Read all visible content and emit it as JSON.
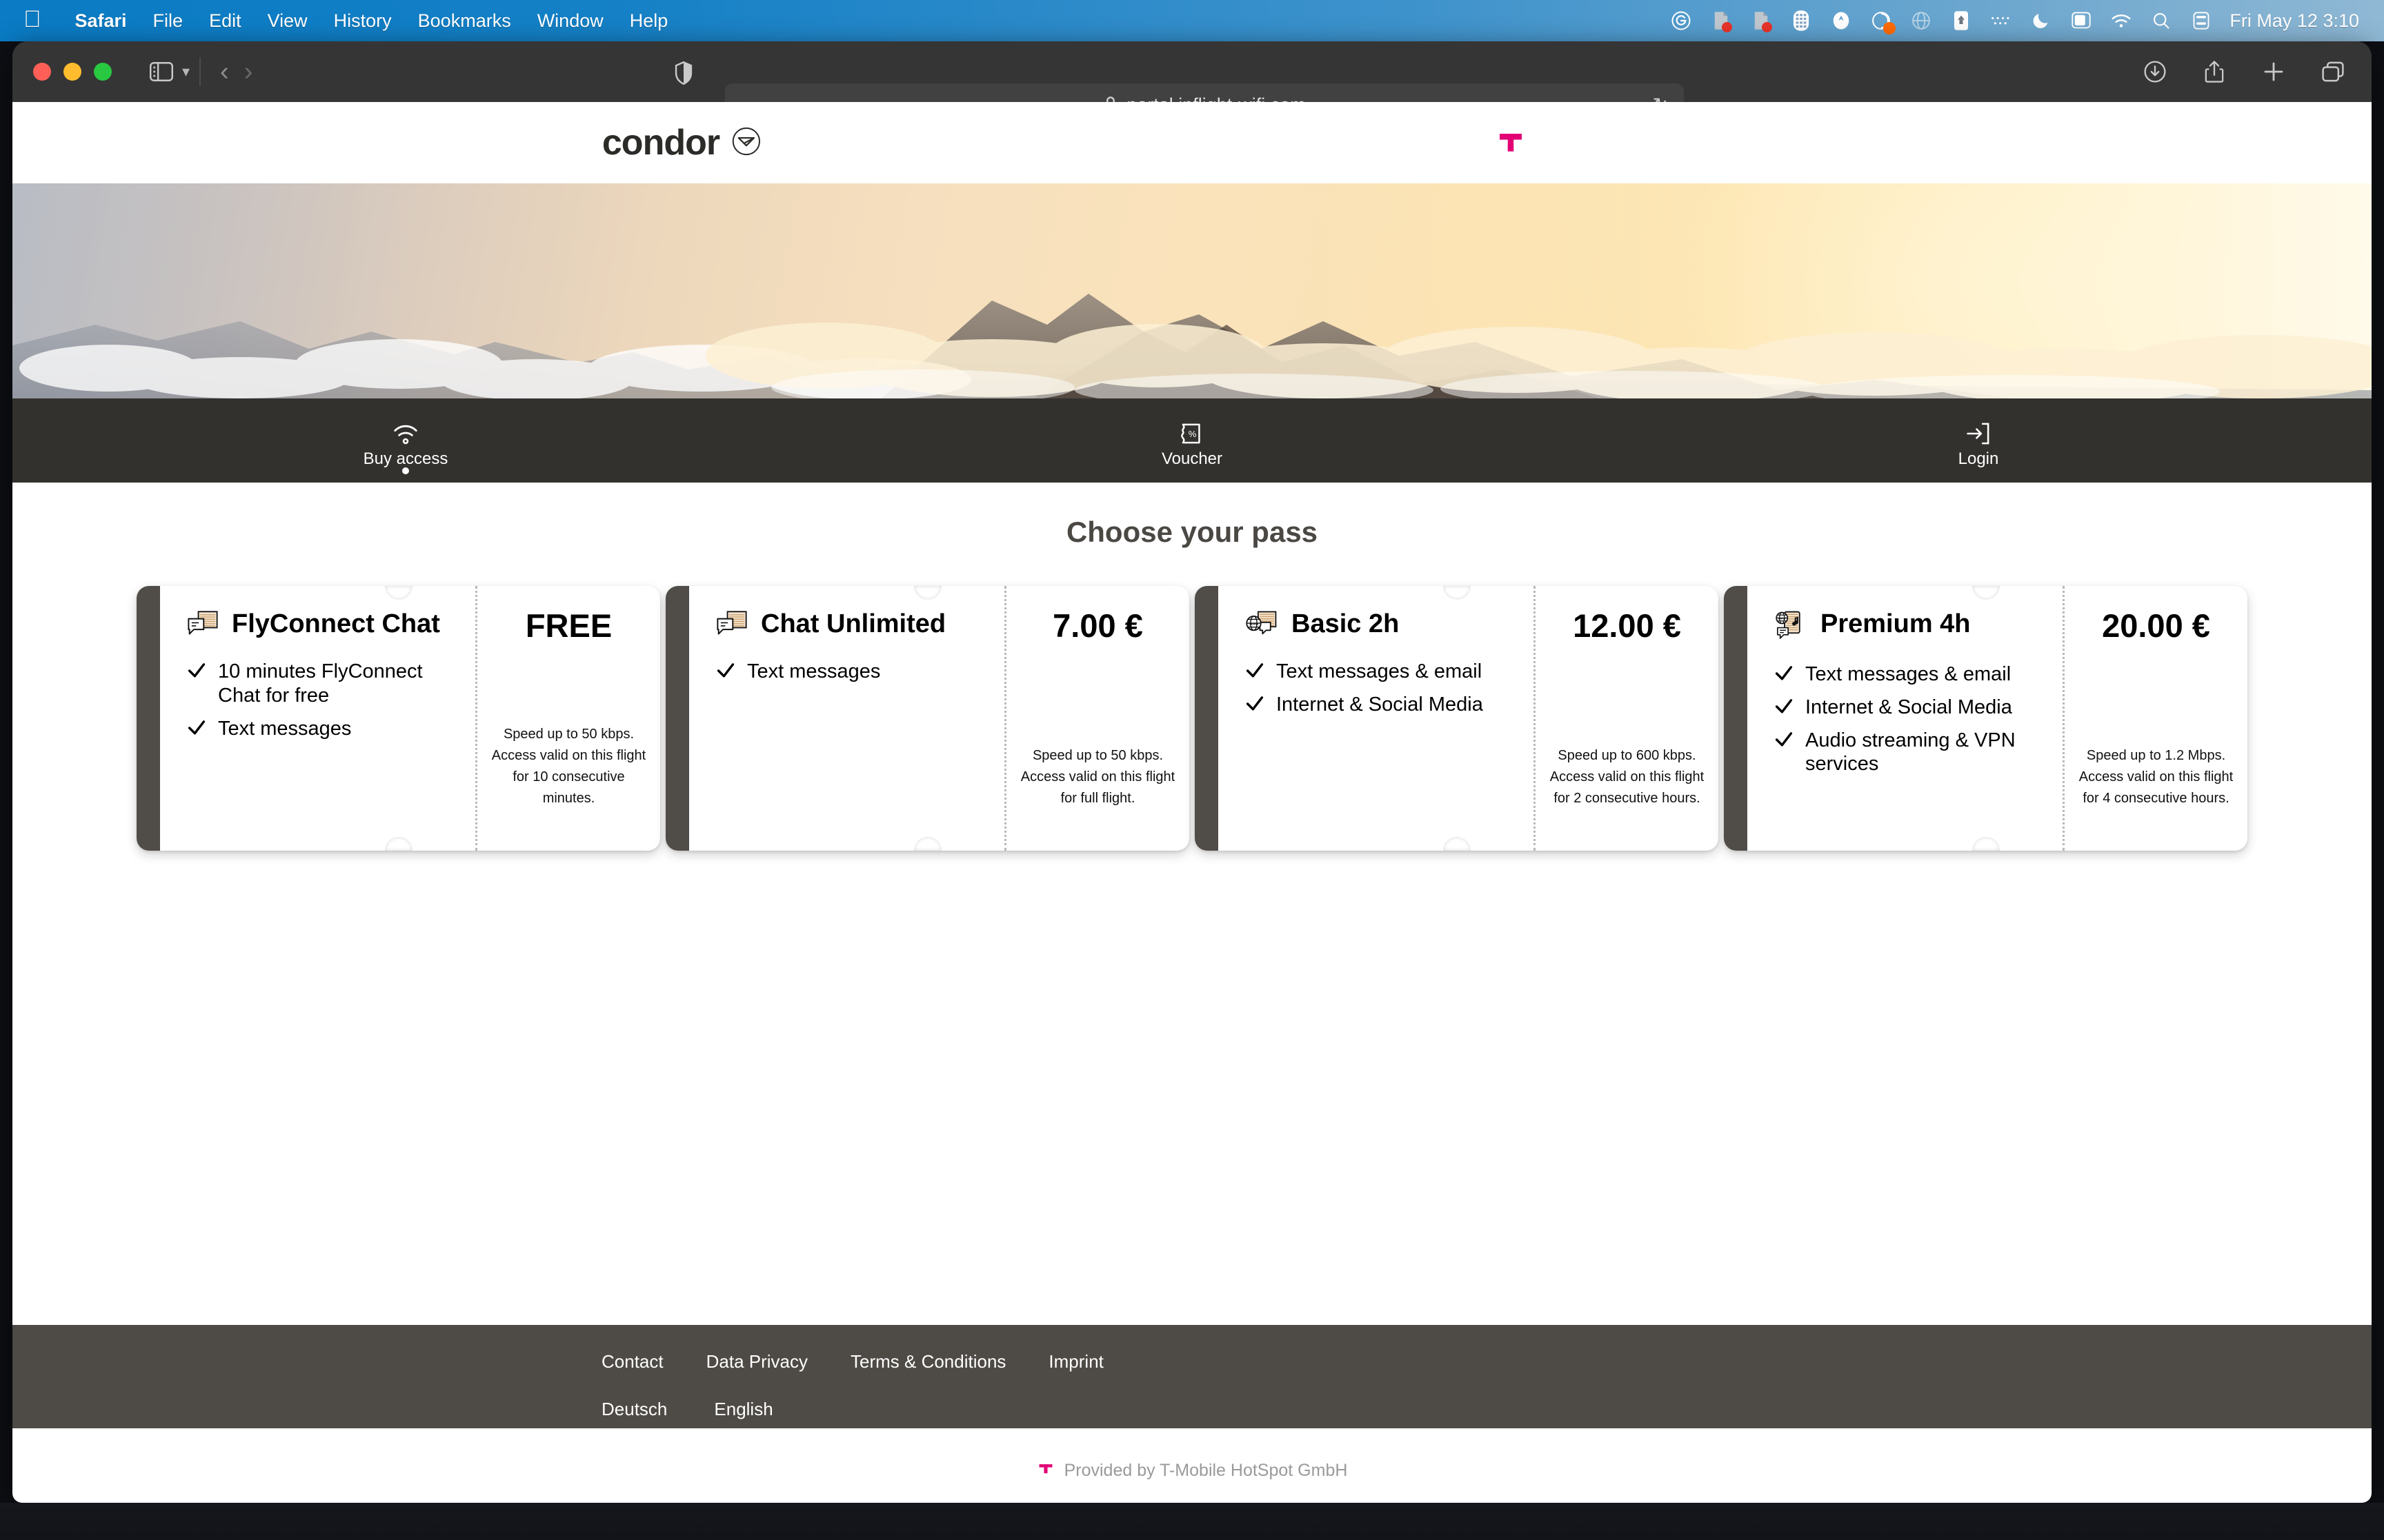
{
  "menubar": {
    "apple_icon": "apple-logo",
    "items": [
      {
        "label": "Safari",
        "bold": true
      },
      {
        "label": "File",
        "bold": false
      },
      {
        "label": "Edit",
        "bold": false
      },
      {
        "label": "View",
        "bold": false
      },
      {
        "label": "History",
        "bold": false
      },
      {
        "label": "Bookmarks",
        "bold": false
      },
      {
        "label": "Window",
        "bold": false
      },
      {
        "label": "Help",
        "bold": false
      }
    ],
    "status_icons": [
      "grammarly-icon",
      "notes-badge-icon",
      "notes-badge-icon-2",
      "calculator-icon",
      "malwarebytes-icon",
      "cleanmymac-icon",
      "globe-icon",
      "dropbox-icon",
      "bluetooth-text-icon",
      "do-not-disturb-moon-icon",
      "display-icon",
      "wifi-icon",
      "spotlight-search-icon",
      "control-center-icon"
    ],
    "clock": "Fri May 12  3:10"
  },
  "browser": {
    "window_controls": [
      "close",
      "minimize",
      "zoom"
    ],
    "sidebar_icon": "sidebar-toggle-icon",
    "sidebar_chevron": "chevron-down-icon",
    "back_arrow": "back-arrow-icon",
    "forward_arrow": "forward-arrow-icon",
    "shield_icon": "privacy-shield-icon",
    "lock_icon": "lock-icon",
    "url": "portal.inflight-wifi.com",
    "reload_icon": "reload-icon",
    "right_icons": [
      "downloads-icon",
      "share-icon",
      "new-tab-icon",
      "tab-overview-icon"
    ]
  },
  "site": {
    "brand_name": "condor",
    "brand_mark": "condor-bird-logo",
    "operator_logo": "t-mobile-logo",
    "hero_image": "sunset-mountain-clouds-photo"
  },
  "nav": {
    "tabs": [
      {
        "label": "Buy access",
        "icon": "wifi-icon",
        "active": true
      },
      {
        "label": "Voucher",
        "icon": "voucher-ticket-icon",
        "active": false
      },
      {
        "label": "Login",
        "icon": "login-arrow-icon",
        "active": false
      }
    ]
  },
  "main": {
    "title": "Choose your pass",
    "passes": [
      {
        "name": "FlyConnect Chat",
        "icon": "chat-bubbles-icon",
        "price": "FREE",
        "features": [
          "10 minutes FlyConnect Chat for free",
          "Text messages"
        ],
        "note": "Speed up to 50 kbps. Access valid on this flight for 10 consecutive minutes."
      },
      {
        "name": "Chat Unlimited",
        "icon": "chat-bubbles-icon",
        "price": "7.00 €",
        "features": [
          "Text messages"
        ],
        "note": "Speed up to 50 kbps. Access valid on this flight for full flight."
      },
      {
        "name": "Basic 2h",
        "icon": "globe-chat-icon",
        "price": "12.00 €",
        "features": [
          "Text messages & email",
          "Internet & Social Media"
        ],
        "note": "Speed up to 600 kbps. Access valid on this flight for 2 consecutive hours."
      },
      {
        "name": "Premium 4h",
        "icon": "globe-chat-music-icon",
        "price": "20.00 €",
        "features": [
          "Text messages & email",
          "Internet & Social Media",
          "Audio streaming & VPN services"
        ],
        "note": "Speed up to 1.2 Mbps. Access valid on this flight for 4 consecutive hours."
      }
    ]
  },
  "footer": {
    "links": [
      "Contact",
      "Data Privacy",
      "Terms & Conditions",
      "Imprint"
    ],
    "languages": [
      "Deutsch",
      "English"
    ],
    "provided_logo": "t-mobile-logo",
    "provided_by": "Provided by T-Mobile HotSpot GmbH"
  },
  "colors": {
    "menubar_blue": "#1480c6",
    "brand_dark": "#2b2b28",
    "magenta": "#e20074",
    "nav_dark": "#33312e",
    "footer_dark": "#4e4a45",
    "stub_dark": "#504c47"
  }
}
